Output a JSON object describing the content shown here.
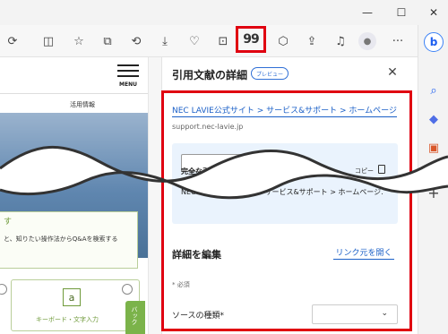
{
  "window": {
    "minimize_icon": "minimize-icon",
    "maximize_icon": "maximize-icon",
    "close_icon": "close-icon"
  },
  "toolbar": {
    "icons": [
      "refresh-icon",
      "split-screen-icon",
      "favorites-star-icon",
      "collections-icon",
      "history-icon",
      "downloads-icon",
      "performance-icon",
      "screenshot-icon",
      "cite-icon",
      "extensions-icon",
      "share-icon",
      "read-aloud-icon",
      "profile-icon",
      "more-icon"
    ],
    "cite_button_glyph": "99",
    "more_glyph": "···"
  },
  "edge_sidebar": {
    "icons": [
      "bing-icon",
      "search-icon",
      "tag-icon",
      "toolbox-icon",
      "add-icon"
    ],
    "add_glyph": "+"
  },
  "web_page": {
    "menu_label": "MENU",
    "nav_item": "活用情報",
    "box_heading": "す",
    "box_text": "と、知りたい操作法からQ&Aを検索する",
    "keyboard_label": "キーボード・文字入力",
    "keyboard_key": "a",
    "feedback_label": "バック"
  },
  "panel": {
    "title": "引用文献の詳細",
    "badge": "プレビュー",
    "close_glyph": "✕",
    "source_link": "NEC LAVIE公式サイト > サービス&サポート > ホームページ",
    "source_domain": "support.nec-lavie.jp",
    "full_citation_label": "完全な引用",
    "copy_label": "コピー",
    "citation_text": "NEC LAVIE公式サイト > サービス&サポート > ホームページ.",
    "edit_title": "詳細を編集",
    "open_link": "リンク元を開く",
    "required_note": "* 必須",
    "source_type_label": "ソースの種類*",
    "source_type_value": ""
  },
  "colors": {
    "highlight": "#e00010",
    "link": "#1a5fc7",
    "citation_bg": "#eaf3fd",
    "page_green": "#6f9a3a"
  }
}
